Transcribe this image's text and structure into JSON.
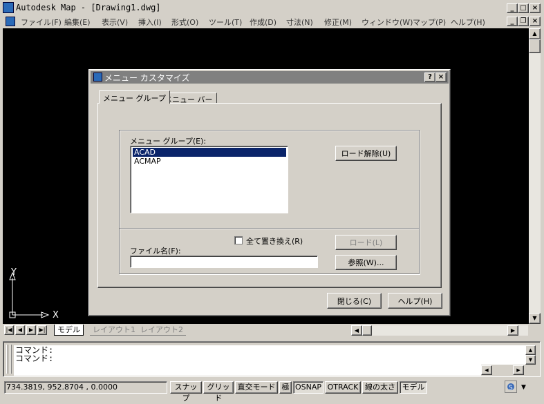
{
  "app": {
    "title": "Autodesk Map - [Drawing1.dwg]",
    "min_glyph": "_",
    "max_glyph": "□",
    "close_glyph": "×",
    "restore_glyph": "❐"
  },
  "menu": {
    "items": [
      "ファイル(F)",
      "編集(E)",
      "表示(V)",
      "挿入(I)",
      "形式(O)",
      "ツール(T)",
      "作成(D)",
      "寸法(N)",
      "修正(M)",
      "ウィンドウ(W)",
      "マップ(P)",
      "ヘルプ(H)"
    ]
  },
  "ucs": {
    "y_label": "Y",
    "x_label": "X"
  },
  "layout_tabs": [
    "モデル",
    "レイアウト1",
    "レイアウト2"
  ],
  "command": {
    "lines": [
      "コマンド:",
      "コマンド:"
    ]
  },
  "status": {
    "coords": "734.3819,  952.8704 , 0.0000",
    "buttons": [
      "スナップ",
      "グリッド",
      "直交モード",
      "極",
      "OSNAP",
      "OTRACK",
      "線の太さ",
      "モデル"
    ]
  },
  "dialog": {
    "title": "メニュー カスタマイズ",
    "help_glyph": "?",
    "close_glyph": "×",
    "tabs": [
      "メニュー グループ",
      "メニュー バー"
    ],
    "group_label": "メニュー グループ(E):",
    "groups": [
      "ACAD",
      "ACMAP"
    ],
    "selected_index": 0,
    "unload_button": "ロード解除(U)",
    "replace_all_label": "全て置き換え(R)",
    "replace_all_checked": false,
    "filename_label": "ファイル名(F):",
    "filename_value": "",
    "load_button": "ロード(L)",
    "browse_button": "参照(W)...",
    "close_button": "閉じる(C)",
    "help_button": "ヘルプ(H)"
  },
  "colors": {
    "canvas": "#000000",
    "selection": "#0a246a",
    "dialog_title_inactive": "#808080"
  }
}
